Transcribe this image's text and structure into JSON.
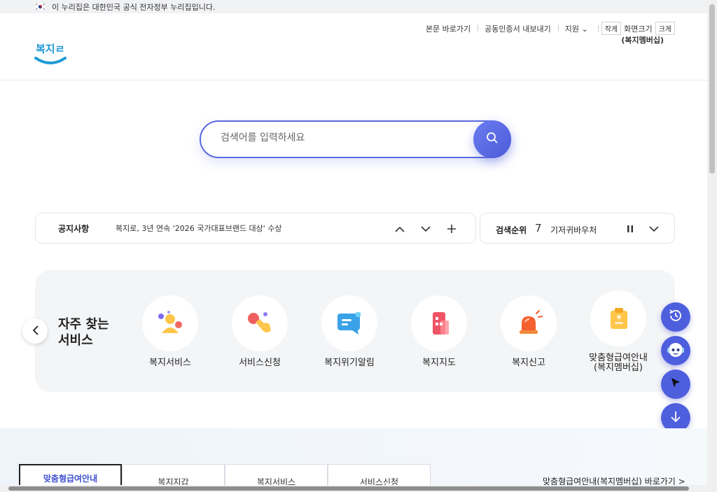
{
  "gov_bar": {
    "text": "이 누리집은 대한민국 공식 전자정부 누리집입니다."
  },
  "header": {
    "logo_text": "복지로",
    "util_links": [
      "본문 바로가기",
      "공동인증서 내보내기",
      "지원"
    ],
    "font_small": "작게",
    "font_label": "화면크기",
    "font_large": "크게",
    "sub_text": "(복지멤버십)"
  },
  "search": {
    "placeholder": "검색어를 입력하세요",
    "value": ""
  },
  "notice": {
    "label": "공지사항",
    "text": "복지로, 3년 연속 '2026 국가대표브랜드 대상' 수상"
  },
  "ranking": {
    "label": "검색순위",
    "rank": "7",
    "term": "기저귀바우처"
  },
  "services": {
    "title_line1": "자주 찾는",
    "title_line2": "서비스",
    "items": [
      {
        "label": "복지서비스",
        "icon": "people-icon"
      },
      {
        "label": "서비스신청",
        "icon": "hand-click-icon"
      },
      {
        "label": "복지위기알림",
        "icon": "message-icon"
      },
      {
        "label": "복지지도",
        "icon": "building-icon"
      },
      {
        "label": "복지신고",
        "icon": "siren-icon"
      },
      {
        "label": "맞춤형급여안내\n(복지멤버십)",
        "icon": "clipboard-icon"
      }
    ]
  },
  "bottom_tabs": [
    "맞춤형급여안내",
    "복지지갑",
    "복지서비스",
    "서비스신청"
  ],
  "bottom_link": "맞춤형급여안내(복지멤버십) 바로가기 >",
  "colors": {
    "accent": "#4e5fde",
    "logo_blue": "#2196d3"
  }
}
